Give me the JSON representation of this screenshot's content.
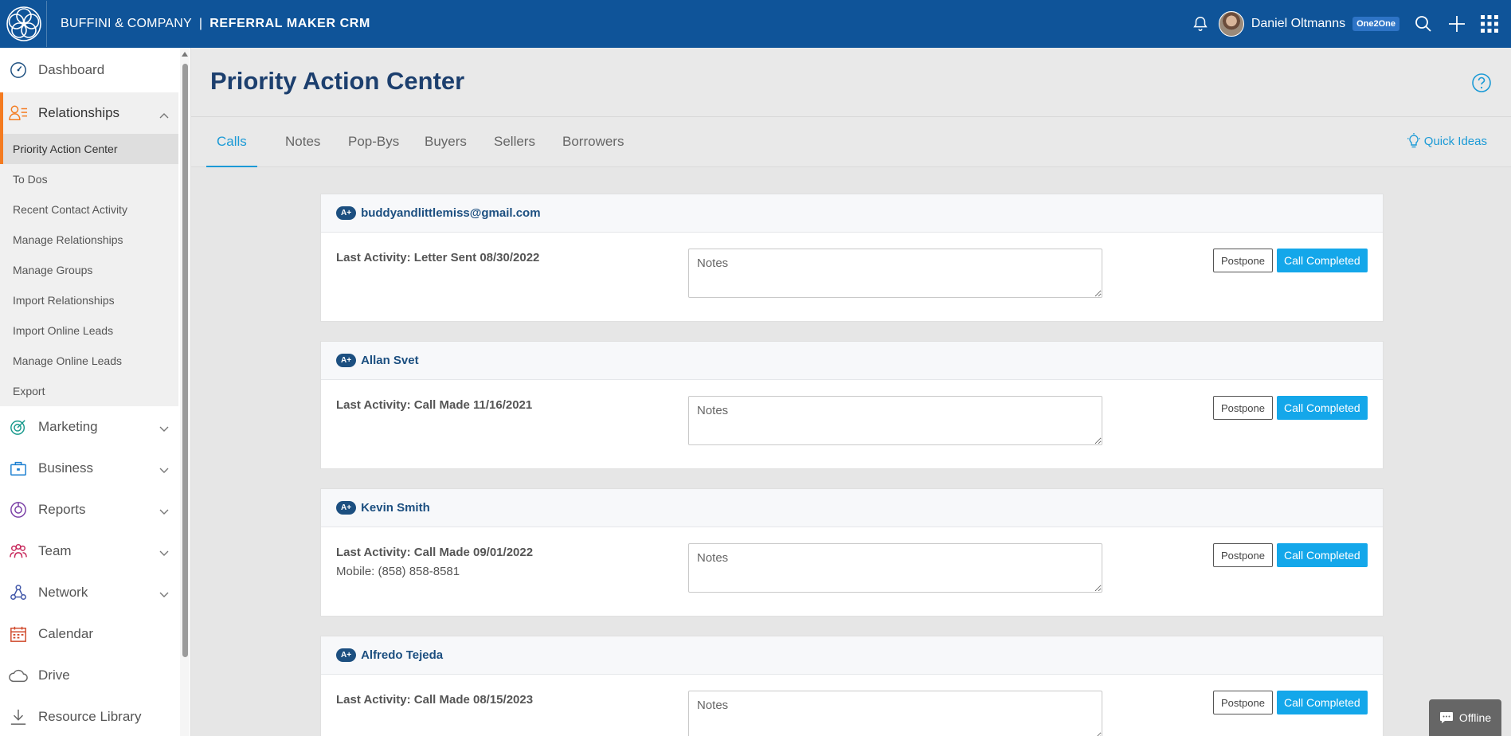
{
  "header": {
    "brand": "BUFFINI & COMPANY",
    "separator": "|",
    "product": "REFERRAL MAKER CRM",
    "user_name": "Daniel Oltmanns",
    "user_badge": "One2One"
  },
  "sidebar": {
    "items": [
      {
        "label": "Dashboard",
        "icon": "dashboard-icon"
      },
      {
        "label": "Relationships",
        "icon": "relationships-icon"
      },
      {
        "label": "Marketing",
        "icon": "marketing-icon"
      },
      {
        "label": "Business",
        "icon": "briefcase-icon"
      },
      {
        "label": "Reports",
        "icon": "reports-icon"
      },
      {
        "label": "Team",
        "icon": "team-icon"
      },
      {
        "label": "Network",
        "icon": "network-icon"
      },
      {
        "label": "Calendar",
        "icon": "calendar-icon"
      },
      {
        "label": "Drive",
        "icon": "cloud-icon"
      },
      {
        "label": "Resource Library",
        "icon": "download-icon"
      }
    ],
    "sub_items": [
      "Priority Action Center",
      "To Dos",
      "Recent Contact Activity",
      "Manage Relationships",
      "Manage Groups",
      "Import Relationships",
      "Import Online Leads",
      "Manage Online Leads",
      "Export"
    ]
  },
  "page": {
    "title": "Priority Action Center",
    "tabs": [
      "Calls",
      "Notes",
      "Pop-Bys",
      "Buyers",
      "Sellers",
      "Borrowers"
    ],
    "active_tab": "Calls",
    "quick_ideas": "Quick Ideas"
  },
  "cards": [
    {
      "badge": "A+",
      "name": "buddyandlittlemiss@gmail.com",
      "activity": "Last Activity: Letter Sent 08/30/2022",
      "mobile": ""
    },
    {
      "badge": "A+",
      "name": "Allan Svet",
      "activity": "Last Activity: Call Made 11/16/2021",
      "mobile": ""
    },
    {
      "badge": "A+",
      "name": "Kevin Smith",
      "activity": "Last Activity: Call Made 09/01/2022",
      "mobile": "Mobile: (858) 858-8581"
    },
    {
      "badge": "A+",
      "name": "Alfredo Tejeda",
      "activity": "Last Activity: Call Made 08/15/2023",
      "mobile": ""
    }
  ],
  "card_labels": {
    "notes_placeholder": "Notes",
    "postpone": "Postpone",
    "call_completed": "Call Completed"
  },
  "chat": {
    "label": "Offline"
  },
  "colors": {
    "topbar": "#0f5499",
    "accent_orange": "#f47b20",
    "tab_active": "#1b9ad6",
    "primary_button": "#14a7ea",
    "title": "#1c3f6e"
  }
}
